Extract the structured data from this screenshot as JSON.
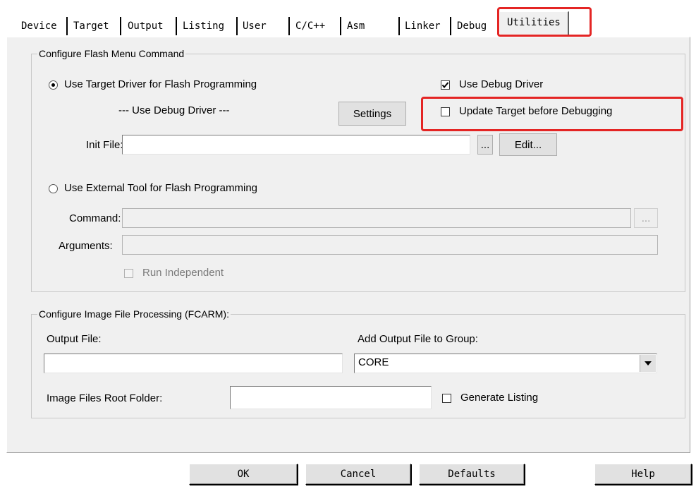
{
  "tabs": [
    {
      "label": "Device"
    },
    {
      "label": "Target"
    },
    {
      "label": "Output"
    },
    {
      "label": "Listing"
    },
    {
      "label": "User"
    },
    {
      "label": "C/C++"
    },
    {
      "label": "Asm"
    },
    {
      "label": "Linker"
    },
    {
      "label": "Debug"
    },
    {
      "label": "Utilities",
      "active": true
    }
  ],
  "flash_group": {
    "title": "Configure Flash Menu Command",
    "use_target_driver": {
      "label": "Use Target Driver for Flash Programming",
      "selected": true
    },
    "driver_name": "--- Use Debug Driver ---",
    "settings_button": "Settings",
    "use_debug_driver": {
      "label": "Use Debug Driver",
      "checked": true
    },
    "update_target": {
      "label": "Update Target before Debugging",
      "checked": false
    },
    "init_file": {
      "label": "Init File:",
      "value": "",
      "browse": "...",
      "edit": "Edit..."
    },
    "use_external_tool": {
      "label": "Use External Tool for Flash Programming",
      "selected": false
    },
    "command": {
      "label": "Command:",
      "value": "",
      "browse": "..."
    },
    "arguments": {
      "label": "Arguments:",
      "value": ""
    },
    "run_independent": {
      "label": "Run Independent",
      "checked": false
    }
  },
  "image_group": {
    "title": "Configure Image File Processing (FCARM):",
    "output_file": {
      "label": "Output File:",
      "value": ""
    },
    "add_output_group": {
      "label": "Add Output File  to Group:",
      "selected": "CORE"
    },
    "root_folder": {
      "label": "Image Files Root Folder:",
      "value": ""
    },
    "generate_listing": {
      "label": "Generate Listing",
      "checked": false
    }
  },
  "footer": {
    "ok": "OK",
    "cancel": "Cancel",
    "defaults": "Defaults",
    "help": "Help"
  },
  "colors": {
    "highlight": "#e42524",
    "dialog_bg": "#f0f0f0"
  }
}
